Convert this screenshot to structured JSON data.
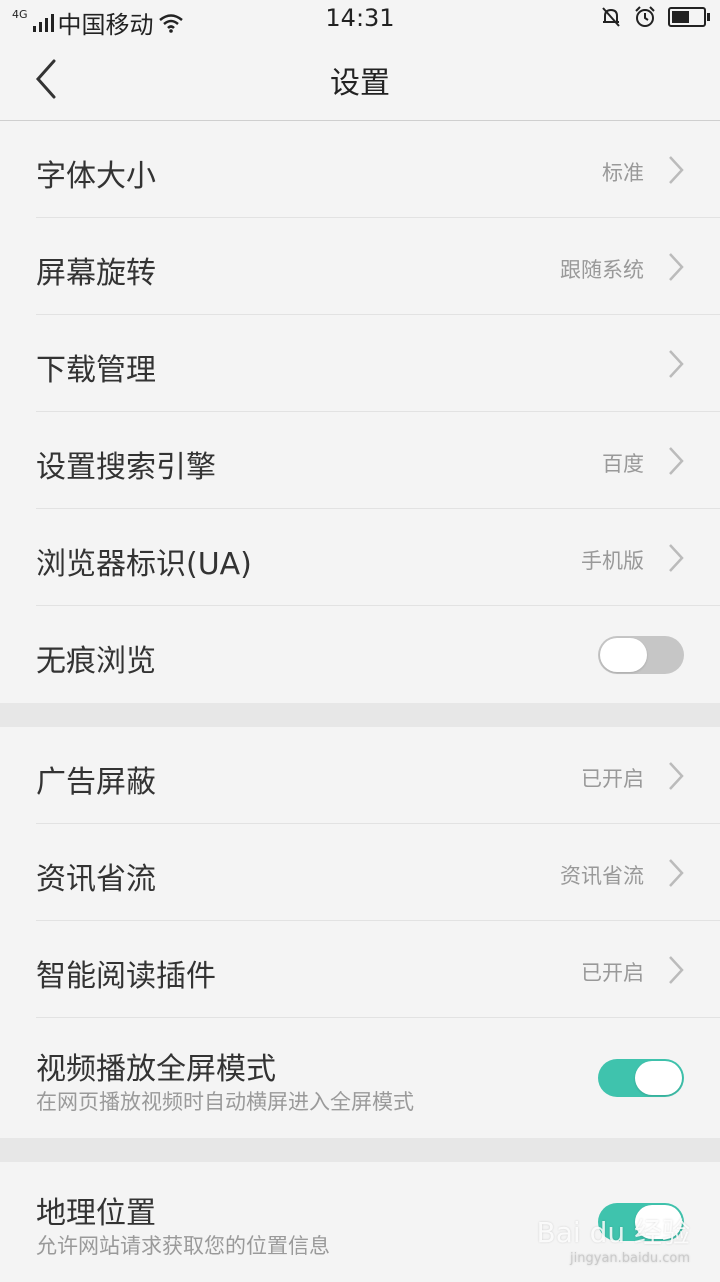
{
  "status_bar": {
    "network": "4G",
    "carrier": "中国移动",
    "time": "14:31",
    "battery_level": 0.6
  },
  "nav": {
    "title": "设置"
  },
  "settings_group_1": [
    {
      "label": "字体大小",
      "value": "标准",
      "type": "chevron"
    },
    {
      "label": "屏幕旋转",
      "value": "跟随系统",
      "type": "chevron"
    },
    {
      "label": "下载管理",
      "value": "",
      "type": "chevron"
    },
    {
      "label": "设置搜索引擎",
      "value": "百度",
      "type": "chevron"
    },
    {
      "label": "浏览器标识(UA)",
      "value": "手机版",
      "type": "chevron"
    },
    {
      "label": "无痕浏览",
      "toggle": "off",
      "type": "toggle"
    }
  ],
  "settings_group_2": [
    {
      "label": "广告屏蔽",
      "value": "已开启",
      "type": "chevron"
    },
    {
      "label": "资讯省流",
      "value": "资讯省流",
      "type": "chevron"
    },
    {
      "label": "智能阅读插件",
      "value": "已开启",
      "type": "chevron"
    },
    {
      "label": "视频播放全屏模式",
      "sub": "在网页播放视频时自动横屏进入全屏模式",
      "toggle": "on",
      "type": "toggle"
    }
  ],
  "settings_group_3": [
    {
      "label": "地理位置",
      "sub": "允许网站请求获取您的位置信息",
      "toggle": "on",
      "type": "toggle"
    }
  ],
  "watermark": {
    "brand": "Bai du 经验",
    "url": "jingyan.baidu.com"
  },
  "colors": {
    "accent": "#3fc3ad",
    "toggle_off": "#c6c6c6",
    "background": "#f4f4f4",
    "secondary_text": "#999999"
  }
}
